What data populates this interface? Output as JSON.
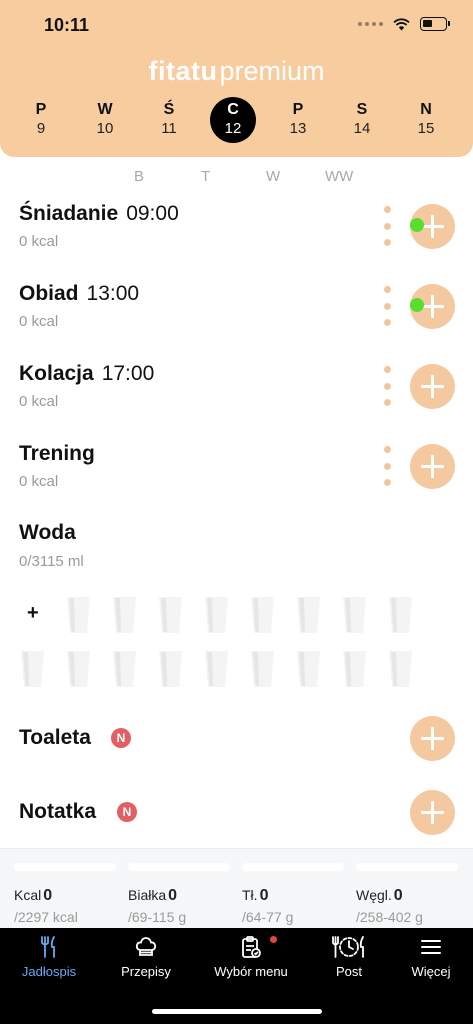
{
  "status_bar": {
    "time": "10:11"
  },
  "header": {
    "brand": "fitatu",
    "plan": "premium",
    "days": [
      {
        "letter": "P",
        "num": "9"
      },
      {
        "letter": "W",
        "num": "10"
      },
      {
        "letter": "Ś",
        "num": "11"
      },
      {
        "letter": "C",
        "num": "12"
      },
      {
        "letter": "P",
        "num": "13"
      },
      {
        "letter": "S",
        "num": "14"
      },
      {
        "letter": "N",
        "num": "15"
      }
    ],
    "active_day_index": 3
  },
  "columns": [
    "B",
    "T",
    "W",
    "WW"
  ],
  "meals": [
    {
      "name": "Śniadanie",
      "time": "09:00",
      "kcal": "0 kcal",
      "has_menu": true,
      "has_indicator": true
    },
    {
      "name": "Obiad",
      "time": "13:00",
      "kcal": "0 kcal",
      "has_menu": true,
      "has_indicator": true
    },
    {
      "name": "Kolacja",
      "time": "17:00",
      "kcal": "0 kcal",
      "has_menu": true,
      "has_indicator": false
    },
    {
      "name": "Trening",
      "time": "",
      "kcal": "0 kcal",
      "has_menu": true,
      "has_indicator": false
    }
  ],
  "water": {
    "title": "Woda",
    "amount": "0/3115 ml",
    "add_label": "+",
    "glasses_total": 17,
    "glasses_filled": 0
  },
  "extras": [
    {
      "name": "Toaleta",
      "badge": "N"
    },
    {
      "name": "Notatka",
      "badge": "N"
    }
  ],
  "nutrients": [
    {
      "label": "Kcal",
      "value": "0",
      "target": "/2297 kcal",
      "progress": 0
    },
    {
      "label": "Białka",
      "value": "0",
      "target": "/69-115 g",
      "progress": 0
    },
    {
      "label": "Tł.",
      "value": "0",
      "target": "/64-77 g",
      "progress": 0
    },
    {
      "label": "Węgl.",
      "value": "0",
      "target": "/258-402 g",
      "progress": 0
    }
  ],
  "tabbar": {
    "items": [
      {
        "label": "Jadłospis",
        "icon": "fork-knife-icon",
        "active": true
      },
      {
        "label": "Przepisy",
        "icon": "chef-hat-icon",
        "active": false
      },
      {
        "label": "Wybór menu",
        "icon": "clipboard-icon",
        "active": false,
        "notification": true
      },
      {
        "label": "Post",
        "icon": "fasting-plate-icon",
        "active": false
      },
      {
        "label": "Więcej",
        "icon": "hamburger-menu-icon",
        "active": false
      }
    ]
  },
  "colors": {
    "header_bg": "#f7cda0",
    "add_button": "#f5c9a0",
    "indicator_green": "#55e02b",
    "badge_red": "#e06063",
    "active_tab": "#6aa8f0"
  }
}
